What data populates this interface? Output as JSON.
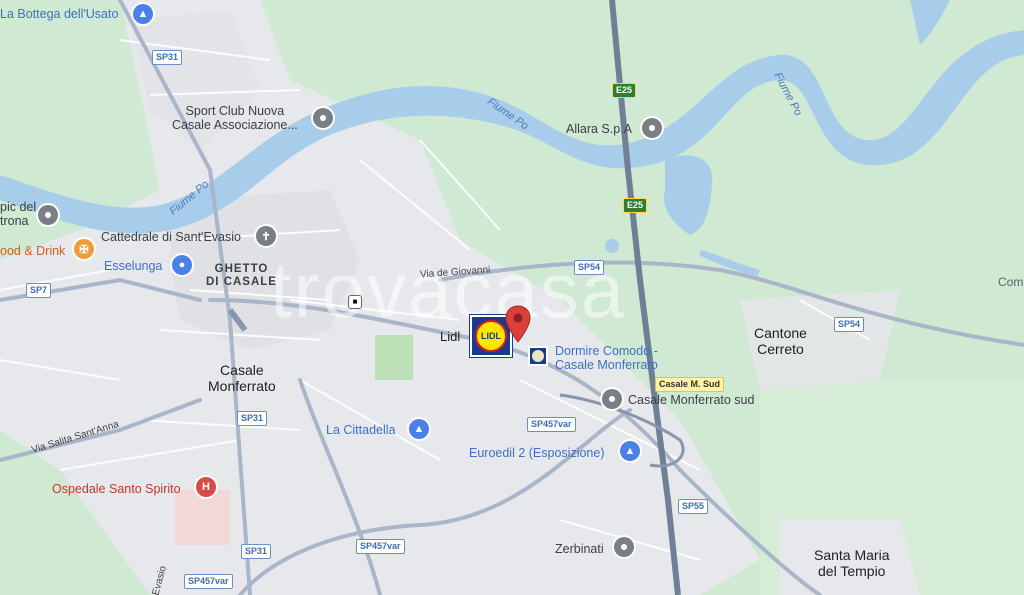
{
  "watermark": "trovacasa",
  "places": {
    "ghetto": "GHETTO\nDI CASALE",
    "casale": "Casale\nMonferrato",
    "cantone": "Cantone\nCerreto",
    "santa_maria": "Santa Maria\ndel Tempio",
    "lidl": "Lidl",
    "partial_right": "Com"
  },
  "water": {
    "fiume_po_1": "Fiume Po",
    "fiume_po_2": "Fiume Po",
    "fiume_po_3": "Fiume Po"
  },
  "roads": {
    "via_de_giovanni": "Via de Giovanni",
    "via_salita": "Via Salita Sant'Anna",
    "evasio": "Evasio"
  },
  "shields": {
    "sp31_top": "SP31",
    "sp31_mid": "SP31",
    "sp31_bot": "SP31",
    "e25_top": "E25",
    "e25_mid": "E25",
    "sp7": "SP7",
    "sp54_a": "SP54",
    "sp54_b": "SP54",
    "sp457_a": "SP457var",
    "sp457_b": "SP457var",
    "sp457_c": "SP457var",
    "sp55": "SP55",
    "exit": "Casale M. Sud"
  },
  "pois": {
    "bottega": "La Bottega dell'Usato",
    "sport_club": "Sport Club Nuova\nCasale Associazione...",
    "allara": "Allara S.p.A",
    "pic_del": "pic del\ntrona",
    "food": "ood & Drink",
    "cattedrale": "Cattedrale di Sant'Evasio",
    "esselunga": "Esselunga",
    "dormire": "Dormire Comodo -\nCasale Monferrato",
    "casale_sud": "Casale Monferrato sud",
    "cittadella": "La Cittadella",
    "euroedil": "Euroedil 2 (Esposizione)",
    "ospedale": "Ospedale Santo Spirito",
    "zerbinati": "Zerbinati",
    "lidl_logo": "LIDL"
  },
  "icons": {
    "bottega": "shopping-bag-icon",
    "sport_club": "place-icon",
    "allara": "place-icon",
    "pic_del": "place-icon",
    "food": "restaurant-icon",
    "cattedrale": "church-cross-icon",
    "esselunga": "shopping-cart-icon",
    "casale_sud": "place-icon",
    "cittadella": "shopping-bag-icon",
    "euroedil": "shopping-bag-icon",
    "ospedale": "hospital-icon",
    "zerbinati": "place-icon",
    "marker": "red-location-pin-icon",
    "train": "train-station-icon"
  },
  "colors": {
    "land": "#cfe9d3",
    "water": "#a7cdea",
    "urban": "#e6e8eb",
    "highway": "#6f7f96",
    "main_road": "#a9b6c9",
    "marker": "#d9403a"
  }
}
